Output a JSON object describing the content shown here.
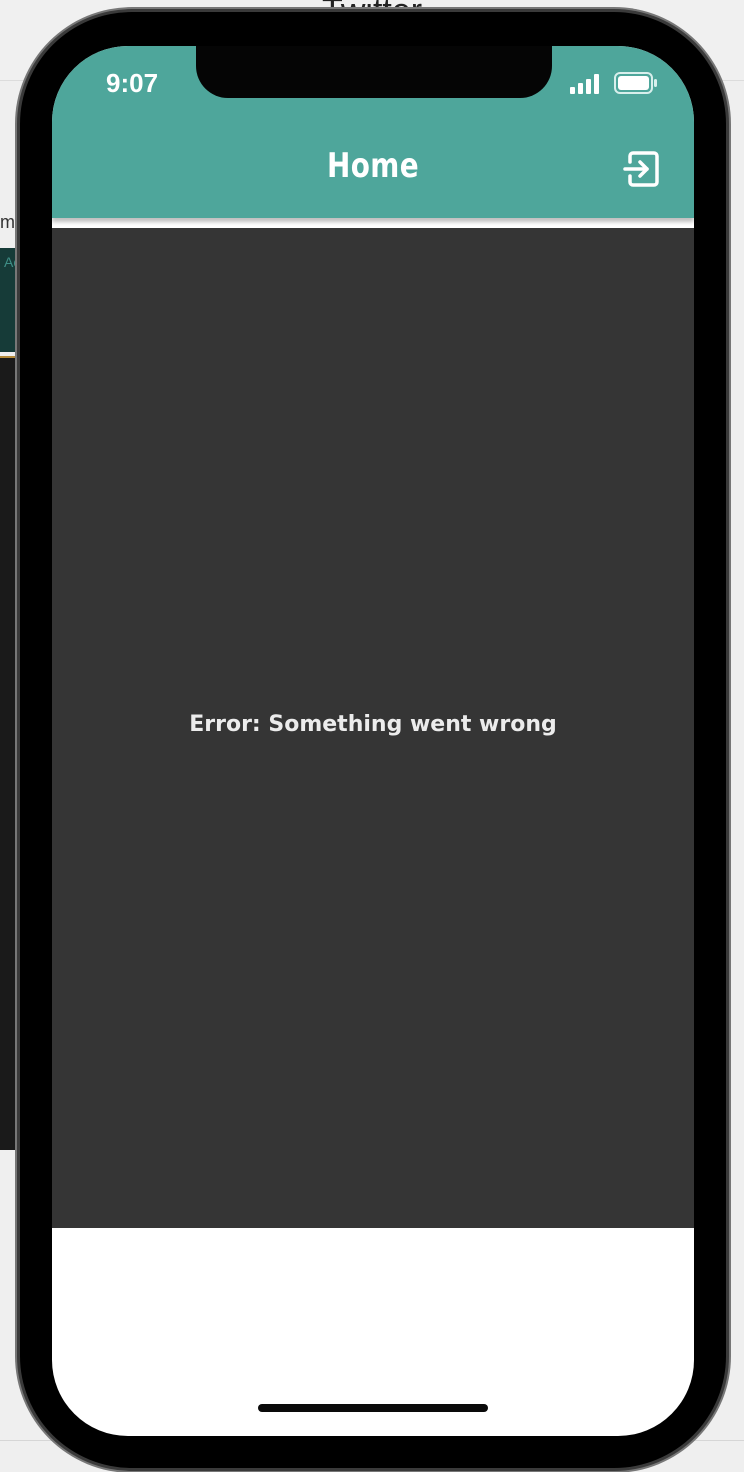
{
  "background_app": {
    "title": "Twitter",
    "side_label": "m",
    "side_tab": "Ac"
  },
  "status_bar": {
    "time": "9:07"
  },
  "header": {
    "title": "Home",
    "logout_icon": "logout-icon"
  },
  "main": {
    "error_message": "Error: Something went wrong"
  },
  "colors": {
    "header": "#4ea69b",
    "content": "#353535",
    "text": "#ffffff"
  }
}
